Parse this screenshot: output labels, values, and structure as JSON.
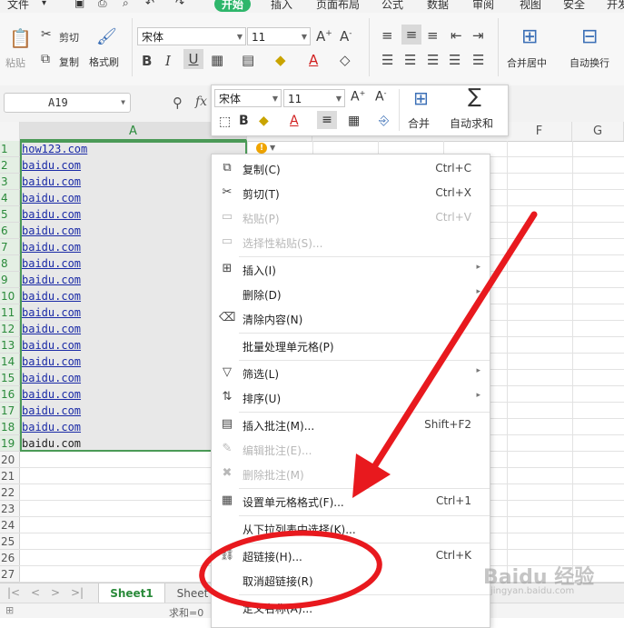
{
  "menu_tabs": [
    "文件",
    "开始",
    "插入",
    "页面布局",
    "公式",
    "数据",
    "审阅",
    "视图",
    "安全",
    "开发"
  ],
  "active_tab": "开始",
  "ribbon": {
    "paste": "粘贴",
    "cut": "剪切",
    "copy": "复制",
    "format_painter": "格式刷",
    "font_name": "宋体",
    "font_size": "11",
    "merge_center": "合并居中",
    "wrap_text": "自动换行"
  },
  "name_box": "A19",
  "fx": "fx",
  "columns": [
    "A",
    "F",
    "G"
  ],
  "rows": [
    "1",
    "2",
    "3",
    "4",
    "5",
    "6",
    "7",
    "8",
    "9",
    "10",
    "11",
    "12",
    "13",
    "14",
    "15",
    "16",
    "17",
    "18",
    "19",
    "20",
    "21",
    "22",
    "23",
    "24",
    "25",
    "26",
    "27"
  ],
  "cells_a": [
    "how123.com",
    "baidu.com",
    "baidu.com",
    "baidu.com",
    "baidu.com",
    "baidu.com",
    "baidu.com",
    "baidu.com",
    "baidu.com",
    "baidu.com",
    "baidu.com",
    "baidu.com",
    "baidu.com",
    "baidu.com",
    "baidu.com",
    "baidu.com",
    "baidu.com",
    "baidu.com",
    "baidu.com"
  ],
  "mini_toolbar": {
    "font_name": "宋体",
    "font_size": "11",
    "merge": "合并",
    "autosum": "自动求和"
  },
  "context_menu": [
    {
      "label": "复制(C)",
      "shortcut": "Ctrl+C",
      "icon": "copy-icon"
    },
    {
      "label": "剪切(T)",
      "shortcut": "Ctrl+X",
      "icon": "scissors-icon"
    },
    {
      "label": "粘贴(P)",
      "shortcut": "Ctrl+V",
      "icon": "paste-icon"
    },
    {
      "label": "选择性粘贴(S)...",
      "shortcut": "",
      "icon": "paste-special-icon"
    },
    {
      "label": "插入(I)",
      "shortcut": "",
      "icon": "insert-icon"
    },
    {
      "label": "删除(D)",
      "shortcut": "",
      "icon": ""
    },
    {
      "label": "清除内容(N)",
      "shortcut": "",
      "icon": "eraser-icon"
    },
    {
      "label": "批量处理单元格(P)",
      "shortcut": "",
      "icon": ""
    },
    {
      "label": "筛选(L)",
      "shortcut": "",
      "icon": "filter-icon"
    },
    {
      "label": "排序(U)",
      "shortcut": "",
      "icon": "sort-icon"
    },
    {
      "label": "插入批注(M)...",
      "shortcut": "Shift+F2",
      "icon": "comment-icon"
    },
    {
      "label": "编辑批注(E)...",
      "shortcut": "",
      "icon": "edit-comment-icon"
    },
    {
      "label": "删除批注(M)",
      "shortcut": "",
      "icon": "delete-comment-icon"
    },
    {
      "label": "设置单元格格式(F)...",
      "shortcut": "Ctrl+1",
      "icon": "format-cells-icon"
    },
    {
      "label": "从下拉列表中选择(K)...",
      "shortcut": "",
      "icon": ""
    },
    {
      "label": "超链接(H)...",
      "shortcut": "Ctrl+K",
      "icon": "link-icon"
    },
    {
      "label": "取消超链接(R)",
      "shortcut": "",
      "icon": ""
    },
    {
      "label": "定义名称(A)...",
      "shortcut": "",
      "icon": ""
    }
  ],
  "sheet_tabs": [
    "Sheet1",
    "Sheet"
  ],
  "status_text": "求和=0",
  "watermark": "Baidu 经验",
  "watermark_url": "jingyan.baidu.com",
  "colors": {
    "accent": "#2eb66b",
    "selection_border": "#4b9a57",
    "annotation": "#e8191e"
  }
}
